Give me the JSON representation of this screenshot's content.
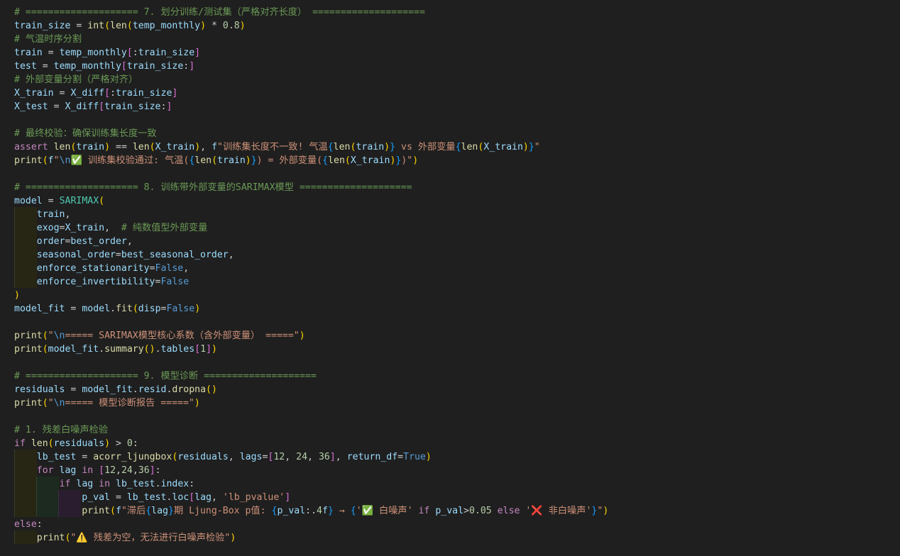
{
  "editor": {
    "lines": [
      "# ==================== 7. 划分训练/测试集（严格对齐长度） ====================",
      "train_size = int(len(temp_monthly) * 0.8)",
      "# 气温时序分割",
      "train = temp_monthly[:train_size]",
      "test = temp_monthly[train_size:]",
      "# 外部变量分割（严格对齐）",
      "X_train = X_diff[:train_size]",
      "X_test = X_diff[train_size:]",
      "",
      "# 最终校验：确保训练集长度一致",
      "assert len(train) == len(X_train), f\"训练集长度不一致! 气温{len(train)} vs 外部变量{len(X_train)}\"",
      "print(f\"\\n✅ 训练集校验通过: 气温({len(train)}) = 外部变量({len(X_train)})\")",
      "",
      "# ==================== 8. 训练带外部变量的SARIMAX模型 ====================",
      "model = SARIMAX(",
      "    train,",
      "    exog=X_train,  # 纯数值型外部变量",
      "    order=best_order,",
      "    seasonal_order=best_seasonal_order,",
      "    enforce_stationarity=False,",
      "    enforce_invertibility=False",
      ")",
      "model_fit = model.fit(disp=False)",
      "",
      "print(\"\\n===== SARIMAX模型核心系数（含外部变量） =====\")",
      "print(model_fit.summary().tables[1])",
      "",
      "# ==================== 9. 模型诊断 ====================",
      "residuals = model_fit.resid.dropna()",
      "print(\"\\n===== 模型诊断报告 =====\")",
      "",
      "# 1. 残差白噪声检验",
      "if len(residuals) > 0:",
      "    lb_test = acorr_ljungbox(residuals, lags=[12, 24, 36], return_df=True)",
      "    for lag in [12,24,36]:",
      "        if lag in lb_test.index:",
      "            p_val = lb_test.loc[lag, 'lb_pvalue']",
      "            print(f\"滞后{lag}期 Ljung-Box p值: {p_val:.4f} → {'✅ 白噪声' if p_val>0.05 else '❌ 非白噪声'}\")",
      "else:",
      "    print(\"⚠️ 残差为空，无法进行白噪声检验\")"
    ]
  }
}
